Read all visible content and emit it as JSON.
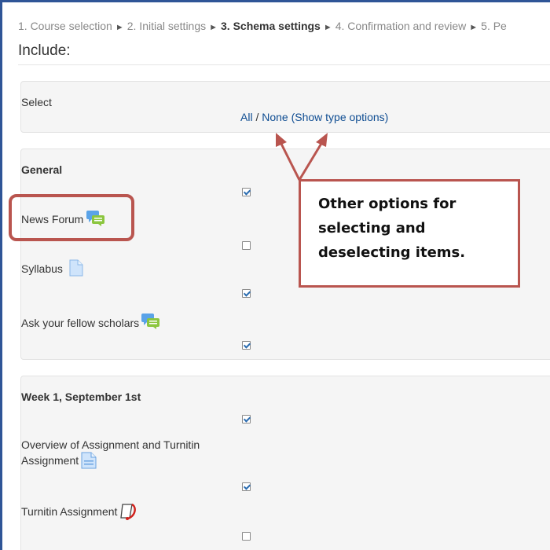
{
  "breadcrumb": [
    {
      "text": "1. Course selection",
      "current": false
    },
    {
      "text": "2. Initial settings",
      "current": false
    },
    {
      "text": "3. Schema settings",
      "current": true
    },
    {
      "text": "4. Confirmation and review",
      "current": false
    },
    {
      "text": "5. Pe",
      "current": false
    }
  ],
  "breadcrumb_separator": "►",
  "heading": "Include:",
  "select_panel": {
    "label": "Select",
    "all_link": "All",
    "slash": " / ",
    "none_link": "None",
    "type_options_link": "(Show type options)"
  },
  "general_section": {
    "title": "General",
    "section_checked": true,
    "items": [
      {
        "label": "News Forum",
        "icon": "forum-icon",
        "checked": false
      },
      {
        "label": "Syllabus",
        "icon": "file-icon",
        "checked": true
      },
      {
        "label": "Ask your fellow scholars",
        "icon": "forum-icon",
        "checked": true
      }
    ]
  },
  "week_section": {
    "title": "Week 1, September 1st",
    "section_checked": true,
    "items": [
      {
        "label_line1": "Overview of Assignment and Turnitin",
        "label_line2": "Assignment",
        "icon": "assignment-icon",
        "checked": true
      },
      {
        "label": "Turnitin Assignment",
        "icon": "turnitin-icon",
        "checked": false
      }
    ]
  },
  "callout": {
    "line1": "Other options for",
    "line2": "selecting and",
    "line3": "deselecting items."
  },
  "colors": {
    "frame_border": "#2f5597",
    "callout_border": "#b9554f",
    "link": "#0f4d92",
    "panel_bg": "#f5f5f5"
  }
}
